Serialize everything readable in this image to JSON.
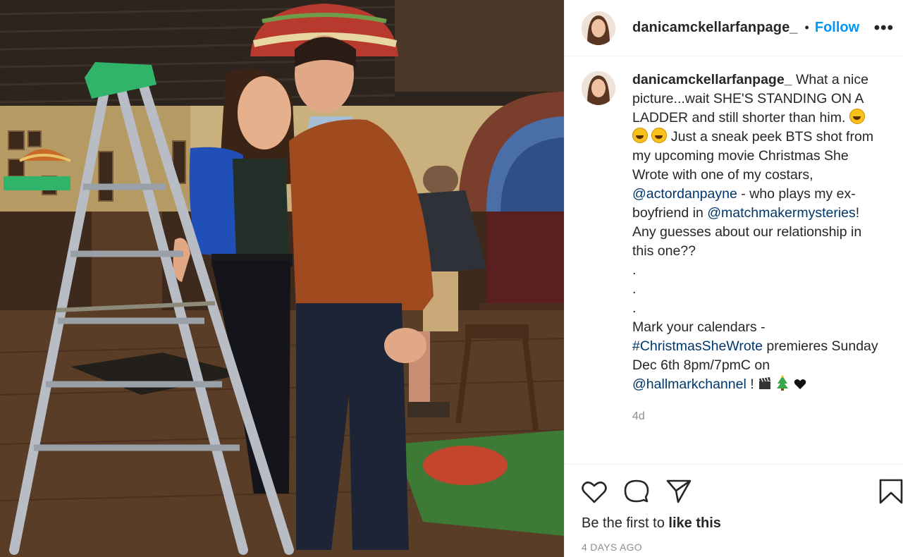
{
  "post": {
    "username": "danicamckellarfanpage_",
    "separator": "•",
    "follow_label": "Follow",
    "more_label": "•••",
    "photo_alt": "Photo of two people standing next to a ladder"
  },
  "caption": {
    "username": "danicamckellarfanpage_",
    "text_1": "What a nice picture...wait SHE'S STANDING ON A LADDER and still shorter than him.",
    "text_2": "Just a sneak peek BTS shot from my upcoming movie Christmas She Wrote with one of my costars,",
    "mention_1": "@actordanpayne",
    "text_3": "- who plays my ex-boyfriend in",
    "mention_2": "@matchmakermysteries",
    "text_4": "! Any guesses about our relationship in this one??",
    "dot_1": ".",
    "dot_2": ".",
    "dot_3": ".",
    "text_5": "Mark your calendars -",
    "hashtag": "#ChristmasSheWrote",
    "text_6": "premieres Sunday Dec 6th 8pm/7pmC on",
    "mention_3": "@hallmarkchannel",
    "text_7": "!",
    "emoji_names": [
      "rolling-on-floor-laughing",
      "clapper-board",
      "christmas-tree",
      "black-heart"
    ],
    "time": "4d"
  },
  "actions": {
    "icons": [
      "heart-icon",
      "comment-icon",
      "share-icon",
      "bookmark-icon"
    ],
    "likes_prefix": "Be the first to",
    "likes_bold": "like this",
    "timestamp": "4 DAYS AGO"
  }
}
